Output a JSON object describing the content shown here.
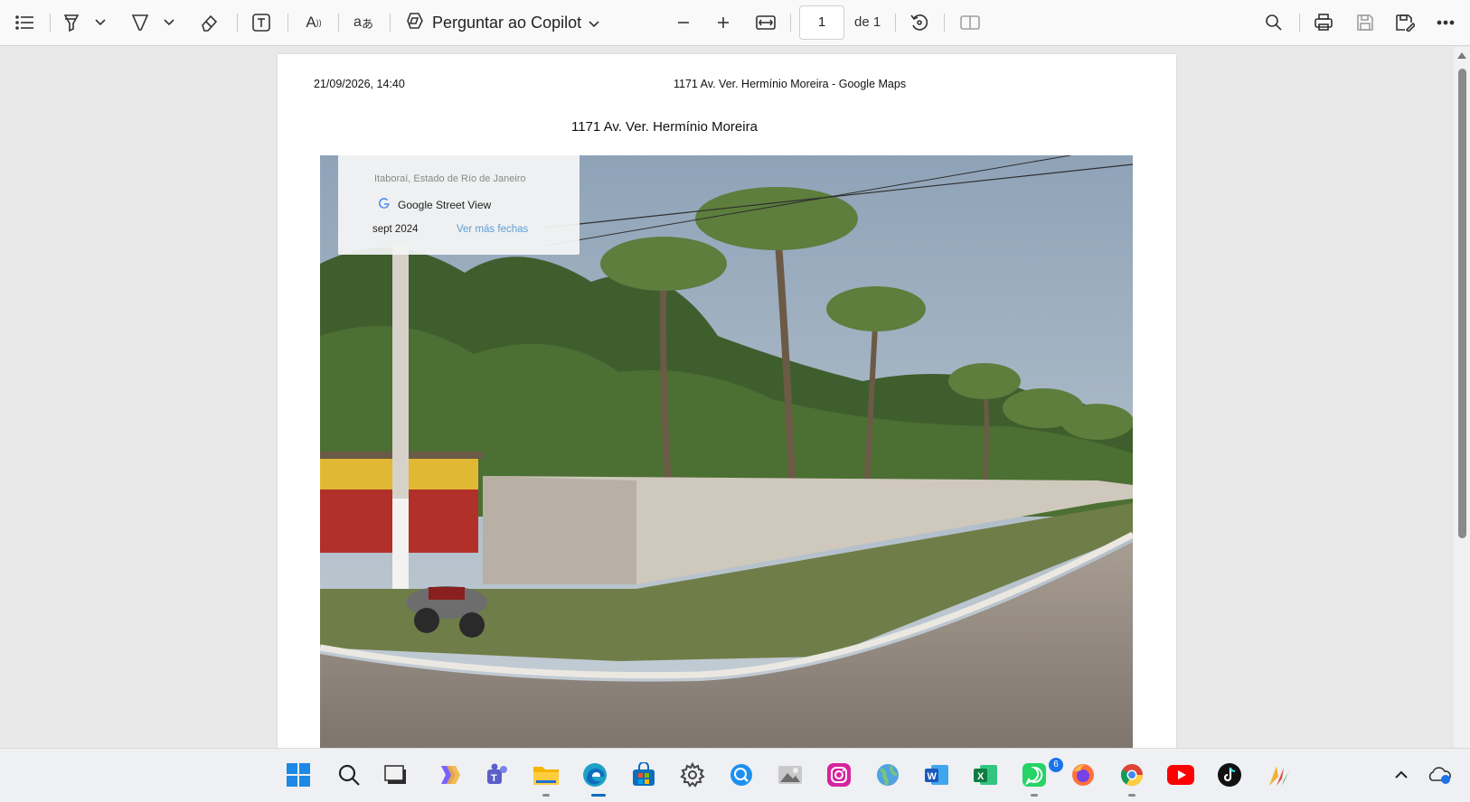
{
  "toolbar": {
    "copilot_label": "Perguntar ao Copilot",
    "page_current": "1",
    "page_total": "de 1",
    "icons": [
      "contents-icon",
      "highlight-icon",
      "draw-icon",
      "erase-icon",
      "textbox-icon",
      "read-aloud-icon",
      "translate-icon",
      "copilot-icon",
      "zoom-out-icon",
      "zoom-in-icon",
      "fit-page-icon",
      "rotate-icon",
      "page-view-icon",
      "search-icon",
      "print-icon",
      "save-icon",
      "save-as-icon",
      "more-icon"
    ]
  },
  "document": {
    "header_date": "21/09/2026, 14:40",
    "header_title": "1171 Av. Ver. Hermínio Moreira - Google Maps",
    "heading": "1171 Av. Ver. Hermínio Moreira",
    "streetview": {
      "location": "Itaboraí, Estado de Río de Janeiro",
      "brand": "Google Street View",
      "date": "sept 2024",
      "more_dates_link": "Ver más fechas"
    }
  },
  "taskbar": {
    "whatsapp_badge": "6",
    "apps": [
      "windows-start-icon",
      "search-icon",
      "task-view-icon",
      "copilot-app-icon",
      "teams-icon",
      "file-explorer-icon",
      "edge-icon",
      "store-icon",
      "settings-icon",
      "quick-assist-icon",
      "photos-icon",
      "instagram-icon",
      "maps-icon",
      "word-icon",
      "excel-icon",
      "whatsapp-icon",
      "firefox-icon",
      "chrome-icon",
      "youtube-icon",
      "tiktok-icon",
      "bird-app-icon"
    ]
  },
  "colors": {
    "accent": "#1a73e8",
    "link": "#5aa0d8"
  }
}
